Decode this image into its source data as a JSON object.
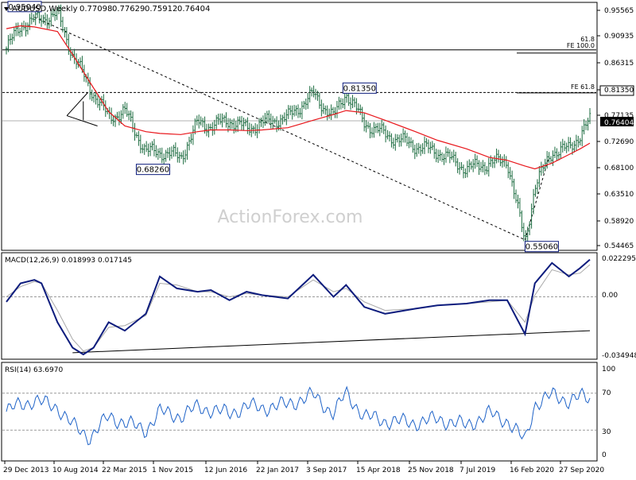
{
  "header": {
    "symbol_label": "AUDUSD,Weekly",
    "ohlc": [
      "0.77098",
      "0.77629",
      "0.75912",
      "0.76404"
    ]
  },
  "watermark": "ActionForex.com",
  "colors": {
    "candle": "#1b6b3f",
    "ma": "#e8161b",
    "macd": "#0d1c7d",
    "signal": "#a8a8a8",
    "rsi": "#1f63c8",
    "label_border": "#0d1c7d",
    "last_price_bg": "#000000"
  },
  "chart_data": [
    {
      "name": "price",
      "type": "line",
      "title": "AUDUSD,Weekly",
      "x": [
        "2013-12-29",
        "2014-03-01",
        "2014-05-01",
        "2014-08-10",
        "2014-10-15",
        "2015-01-01",
        "2015-03-22",
        "2015-06-01",
        "2015-09-01",
        "2015-11-01",
        "2016-02-01",
        "2016-04-15",
        "2016-06-12",
        "2016-09-01",
        "2016-11-15",
        "2017-01-22",
        "2017-05-15",
        "2017-09-03",
        "2017-12-01",
        "2018-01-25",
        "2018-04-15",
        "2018-07-15",
        "2018-11-25",
        "2019-03-01",
        "2019-07-07",
        "2019-10-15",
        "2020-01-01",
        "2020-03-19",
        "2020-05-01",
        "2020-07-15",
        "2020-09-27",
        "2020-11-15",
        "2020-12-28"
      ],
      "yticks": [
        "0.95565",
        "0.90935",
        "0.86315",
        "0.81350",
        "0.77135",
        "0.76404",
        "0.72690",
        "0.68100",
        "0.63510",
        "0.58920",
        "0.54465"
      ],
      "ylim": [
        0.54465,
        0.95565
      ],
      "series": [
        {
          "style": "bars",
          "values": [
            0.89,
            0.93,
            0.94,
            0.95,
            0.88,
            0.82,
            0.77,
            0.78,
            0.71,
            0.71,
            0.7,
            0.76,
            0.755,
            0.765,
            0.75,
            0.76,
            0.77,
            0.81,
            0.77,
            0.8135,
            0.76,
            0.74,
            0.72,
            0.71,
            0.68,
            0.69,
            0.695,
            0.5506,
            0.65,
            0.71,
            0.715,
            0.74,
            0.764
          ]
        },
        {
          "style": "ma",
          "values": [
            0.925,
            0.93,
            0.928,
            0.92,
            0.88,
            0.83,
            0.78,
            0.755,
            0.745,
            0.742,
            0.74,
            0.745,
            0.748,
            0.748,
            0.747,
            0.748,
            0.752,
            0.765,
            0.775,
            0.782,
            0.778,
            0.765,
            0.745,
            0.73,
            0.715,
            0.7,
            0.695,
            0.685,
            0.68,
            0.69,
            0.705,
            0.715,
            0.725
          ]
        }
      ],
      "labels": [
        {
          "text": "0.95040",
          "x": "2013-12-29",
          "y": 0.9504
        },
        {
          "text": "0.68260",
          "x": "2015-09-01",
          "y": 0.6826
        },
        {
          "text": "0.81350",
          "x": "2018-01-25",
          "y": 0.8135
        },
        {
          "text": "0.55060",
          "x": "2020-03-19",
          "y": 0.5506
        }
      ],
      "fib_levels": [
        {
          "text": "61.8",
          "y": 0.894
        },
        {
          "text": "FE 100.0",
          "y": 0.888
        },
        {
          "text": "FE 61.8",
          "y": 0.817
        }
      ],
      "hlines": [
        0.888,
        0.8135,
        0.764
      ],
      "trendline": {
        "from": [
          "2014-05-01",
          0.945
        ],
        "to": [
          "2020-03-19",
          0.556
        ]
      },
      "last_price": "0.76404"
    },
    {
      "name": "macd",
      "type": "line",
      "title": "MACD(12,26,9) 0.018993 0.017145",
      "x": [
        "2013-12-29",
        "2014-03-01",
        "2014-05-01",
        "2014-06-01",
        "2014-08-10",
        "2014-10-15",
        "2014-12-01",
        "2015-01-15",
        "2015-03-22",
        "2015-06-01",
        "2015-09-01",
        "2015-11-01",
        "2016-01-15",
        "2016-04-15",
        "2016-06-12",
        "2016-09-01",
        "2016-11-15",
        "2017-01-22",
        "2017-05-15",
        "2017-09-03",
        "2017-12-01",
        "2018-01-25",
        "2018-04-15",
        "2018-07-15",
        "2018-11-25",
        "2019-03-01",
        "2019-07-07",
        "2019-10-15",
        "2020-01-01",
        "2020-03-19",
        "2020-05-01",
        "2020-07-15",
        "2020-09-27",
        "2020-11-15",
        "2020-12-28"
      ],
      "yticks": [
        "0.022295",
        "0.00",
        "-0.034948"
      ],
      "ylim": [
        -0.034948,
        0.022295
      ],
      "series": [
        {
          "name": "MACD",
          "values": [
            -0.003,
            0.008,
            0.01,
            0.008,
            -0.015,
            -0.03,
            -0.034,
            -0.03,
            -0.015,
            -0.02,
            -0.01,
            0.012,
            0.005,
            0.003,
            0.004,
            -0.002,
            0.003,
            0.001,
            -0.001,
            0.013,
            0.0,
            0.007,
            -0.006,
            -0.01,
            -0.007,
            -0.005,
            -0.004,
            -0.002,
            -0.002,
            -0.022,
            0.008,
            0.02,
            0.012,
            0.017,
            0.022
          ]
        },
        {
          "name": "Signal",
          "values": [
            0.0,
            0.006,
            0.009,
            0.008,
            -0.008,
            -0.025,
            -0.032,
            -0.03,
            -0.018,
            -0.017,
            -0.011,
            0.008,
            0.007,
            0.003,
            0.003,
            0.0,
            0.002,
            0.001,
            0.0,
            0.01,
            0.003,
            0.005,
            -0.003,
            -0.008,
            -0.007,
            -0.005,
            -0.004,
            -0.003,
            -0.002,
            -0.015,
            0.001,
            0.016,
            0.013,
            0.014,
            0.019
          ]
        }
      ],
      "trendline": {
        "from": [
          "2014-10-15",
          -0.033
        ],
        "to": [
          "2020-12-28",
          -0.02
        ]
      },
      "zero_line": "0.00"
    },
    {
      "name": "rsi",
      "type": "line",
      "title": "RSI(14) 63.6970",
      "x": [
        "2013-12-29",
        "2014-03-01",
        "2014-05-01",
        "2014-08-10",
        "2014-10-15",
        "2015-01-01",
        "2015-03-22",
        "2015-06-01",
        "2015-09-01",
        "2015-11-01",
        "2016-02-01",
        "2016-04-15",
        "2016-06-12",
        "2016-09-01",
        "2016-11-15",
        "2017-01-22",
        "2017-05-15",
        "2017-09-03",
        "2017-12-01",
        "2018-01-25",
        "2018-04-15",
        "2018-07-15",
        "2018-11-25",
        "2019-03-01",
        "2019-07-07",
        "2019-10-15",
        "2020-01-01",
        "2020-03-19",
        "2020-05-01",
        "2020-07-15",
        "2020-09-27",
        "2020-11-15",
        "2020-12-28"
      ],
      "yticks": [
        "100",
        "70",
        "30",
        "0"
      ],
      "ylim": [
        0,
        100
      ],
      "series": [
        {
          "name": "RSI",
          "values": [
            50,
            58,
            62,
            55,
            35,
            22,
            45,
            38,
            30,
            50,
            45,
            55,
            52,
            48,
            56,
            54,
            58,
            68,
            48,
            70,
            45,
            40,
            38,
            42,
            35,
            48,
            40,
            18,
            58,
            68,
            62,
            66,
            64
          ]
        }
      ],
      "levels": [
        70,
        30
      ],
      "xticks": [
        "29 Dec 2013",
        "10 Aug 2014",
        "22 Mar 2015",
        "1 Nov 2015",
        "12 Jun 2016",
        "22 Jan 2017",
        "3 Sep 2017",
        "15 Apr 2018",
        "25 Nov 2018",
        "7 Jul 2019",
        "16 Feb 2020",
        "27 Sep 2020"
      ]
    }
  ]
}
